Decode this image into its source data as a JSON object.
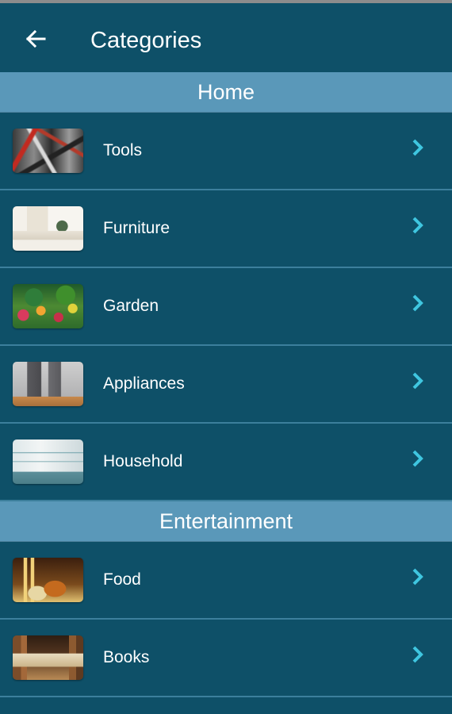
{
  "app_bar": {
    "title": "Categories",
    "back_icon": "arrow-left-icon"
  },
  "sections": [
    {
      "title": "Home",
      "items": [
        {
          "label": "Tools",
          "thumb": "tools-image"
        },
        {
          "label": "Furniture",
          "thumb": "furniture-image"
        },
        {
          "label": "Garden",
          "thumb": "garden-image"
        },
        {
          "label": "Appliances",
          "thumb": "appliances-image"
        },
        {
          "label": "Household",
          "thumb": "household-image"
        }
      ]
    },
    {
      "title": "Entertainment",
      "items": [
        {
          "label": "Food",
          "thumb": "food-image"
        },
        {
          "label": "Books",
          "thumb": "books-image"
        }
      ]
    }
  ],
  "colors": {
    "background": "#0e5068",
    "section_header": "#5a98b9",
    "accent_chevron": "#3fc6e0",
    "divider": "#3c7f9c",
    "text": "#ffffff"
  },
  "icons": {
    "row_chevron": "chevron-right-icon"
  }
}
